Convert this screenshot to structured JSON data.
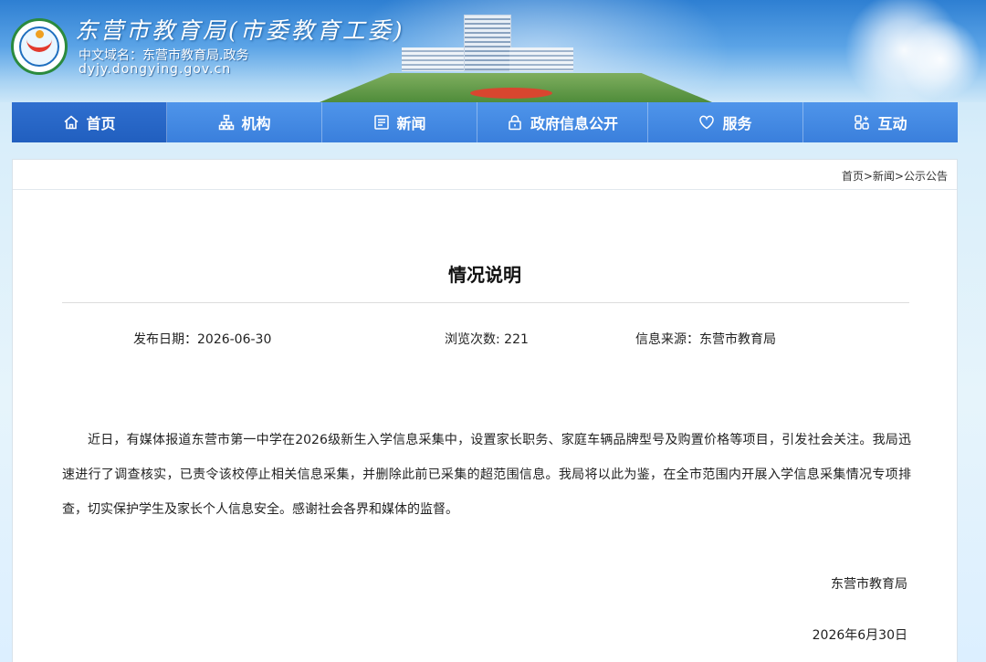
{
  "header": {
    "site_title": "东营市教育局(市委教育工委)",
    "domain_cn": "中文域名：东营市教育局.政务",
    "domain_en": "dyjy.dongying.gov.cn"
  },
  "nav": {
    "items": [
      {
        "label": "首页",
        "icon": "home-icon"
      },
      {
        "label": "机构",
        "icon": "org-chart-icon"
      },
      {
        "label": "新闻",
        "icon": "news-icon"
      },
      {
        "label": "政府信息公开",
        "icon": "lock-icon"
      },
      {
        "label": "服务",
        "icon": "heart-icon"
      },
      {
        "label": "互动",
        "icon": "interaction-icon"
      }
    ],
    "active_index": 0
  },
  "breadcrumb": {
    "home": "首页",
    "sep": ">",
    "news": "新闻",
    "current": "公示公告"
  },
  "article": {
    "title": "情况说明",
    "publish_date": "发布日期：2026-06-30",
    "views": "浏览次数: 221",
    "source": "信息来源：东营市教育局",
    "body": "近日，有媒体报道东营市第一中学在2026级新生入学信息采集中，设置家长职务、家庭车辆品牌型号及购置价格等项目，引发社会关注。我局迅速进行了调查核实，已责令该校停止相关信息采集，并删除此前已采集的超范围信息。我局将以此为鉴，在全市范围内开展入学信息采集情况专项排查，切实保护学生及家长个人信息安全。感谢社会各界和媒体的监督。",
    "sign_org": "东营市教育局",
    "sign_date": "2026年6月30日"
  },
  "colors": {
    "nav_bg": "#3a7fdc",
    "nav_active": "#215fbf",
    "text": "#222222"
  }
}
